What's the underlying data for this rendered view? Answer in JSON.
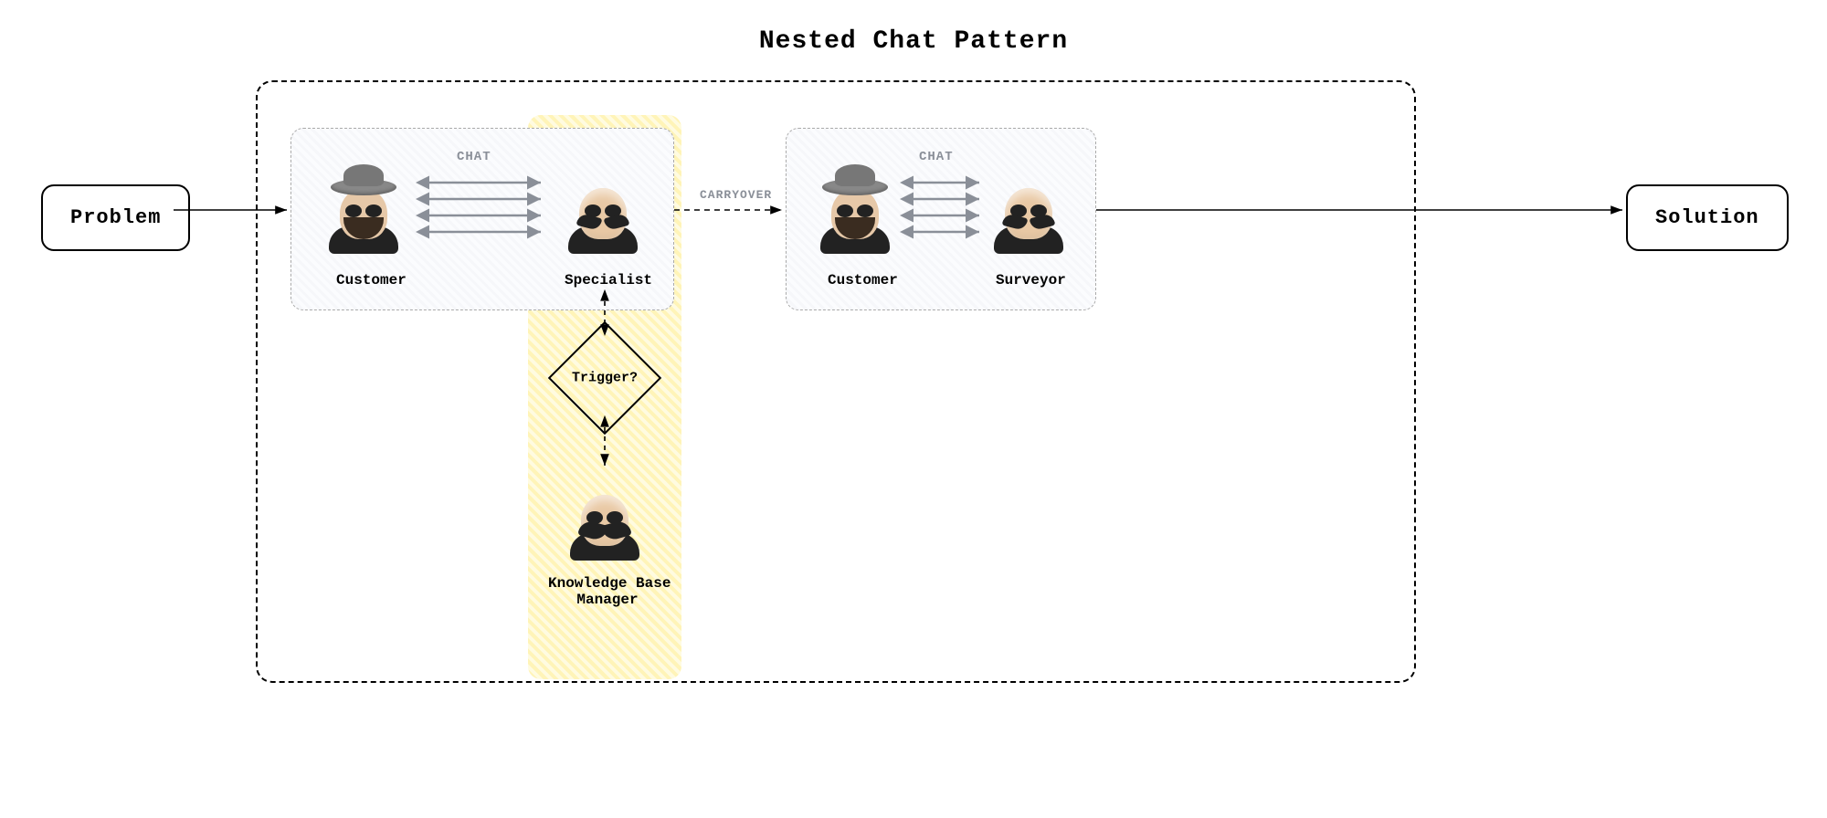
{
  "title": "Nested Chat Pattern",
  "nodes": {
    "problem": "Problem",
    "solution": "Solution"
  },
  "panel1": {
    "chat_label": "CHAT",
    "left_role": "Customer",
    "right_role": "Specialist"
  },
  "panel2": {
    "chat_label": "CHAT",
    "left_role": "Customer",
    "right_role": "Surveyor"
  },
  "carryover_label": "CARRYOVER",
  "decision": "Trigger?",
  "kb_manager_label": "Knowledge Base\nManager"
}
